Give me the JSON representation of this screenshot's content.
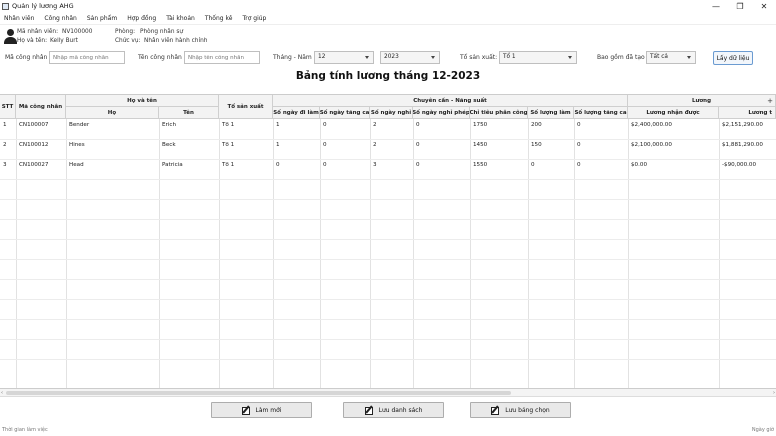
{
  "window": {
    "title": "Quản lý lương AHG",
    "controls": [
      "—",
      "❐",
      "✕"
    ]
  },
  "menu": [
    "Nhân viên",
    "Công nhân",
    "Sản phẩm",
    "Hợp đồng",
    "Tài khoản",
    "Thống kê",
    "Trợ giúp"
  ],
  "user": {
    "id_label": "Mã nhân viên:",
    "id_value": "NV100000",
    "name_label": "Họ và tên:",
    "name_value": "Kelly Burt",
    "dept_label": "Phòng:",
    "dept_value": "Phòng nhân sự",
    "role_label": "Chức vụ:",
    "role_value": "Nhân viên hành chính"
  },
  "filters": {
    "worker_id_label": "Mã công nhân",
    "worker_id_placeholder": "Nhập mã công nhân",
    "worker_name_label": "Tên công nhân",
    "worker_name_placeholder": "Nhập tên công nhân",
    "month_year_label": "Tháng - Năm",
    "month_value": "12",
    "year_value": "2023",
    "team_label": "Tổ sản xuất:",
    "team_value": "Tổ 1",
    "include_trained_label": "Bao gồm đã tạo",
    "include_trained_value": "Tất cả",
    "fetch_button": "Lấy dữ liệu"
  },
  "sheet_title": "Bảng tính lương tháng 12-2023",
  "table": {
    "group_headers": {
      "fullname": "Họ và tên",
      "attendance": "Chuyên cần - Năng suất",
      "salary": "Lương"
    },
    "columns": {
      "stt": "STT",
      "worker_id": "Mã công nhân",
      "last_name": "Họ",
      "first_name": "Tên",
      "team": "Tổ sản xuất",
      "days_worked": "Số ngày đi làm",
      "overtime_days": "Số ngày tăng ca",
      "days_off": "Số ngày nghỉ",
      "leave_days": "Số ngày nghỉ phép",
      "piece_target": "Chỉ tiêu phân công",
      "quantity_made": "Số lượng làm",
      "overtime_quantity": "Số lượng tăng ca",
      "salary_received": "Lương nhận được",
      "salary_net": "Lương t"
    },
    "rows": [
      {
        "stt": "1",
        "worker_id": "CN100007",
        "last_name": "Bender",
        "first_name": "Erich",
        "team": "Tổ 1",
        "days_worked": "1",
        "overtime_days": "0",
        "days_off": "2",
        "leave_days": "0",
        "piece_target": "1750",
        "quantity_made": "200",
        "overtime_quantity": "0",
        "salary_received": "$2,400,000.00",
        "salary_net": "$2,151,290.00"
      },
      {
        "stt": "2",
        "worker_id": "CN100012",
        "last_name": "Hines",
        "first_name": "Beck",
        "team": "Tổ 1",
        "days_worked": "1",
        "overtime_days": "0",
        "days_off": "2",
        "leave_days": "0",
        "piece_target": "1450",
        "quantity_made": "150",
        "overtime_quantity": "0",
        "salary_received": "$2,100,000.00",
        "salary_net": "$1,881,290.00"
      },
      {
        "stt": "3",
        "worker_id": "CN100027",
        "last_name": "Head",
        "first_name": "Patricia",
        "team": "Tổ 1",
        "days_worked": "0",
        "overtime_days": "0",
        "days_off": "3",
        "leave_days": "0",
        "piece_target": "1550",
        "quantity_made": "0",
        "overtime_quantity": "0",
        "salary_received": "$0.00",
        "salary_net": "-$90,000.00"
      }
    ]
  },
  "actions": {
    "refresh": "Làm mới",
    "save_list": "Lưu danh sách",
    "save_selected": "Lưu bảng chọn"
  },
  "status": {
    "left": "Thời gian làm việc",
    "right": "Ngày giờ"
  }
}
